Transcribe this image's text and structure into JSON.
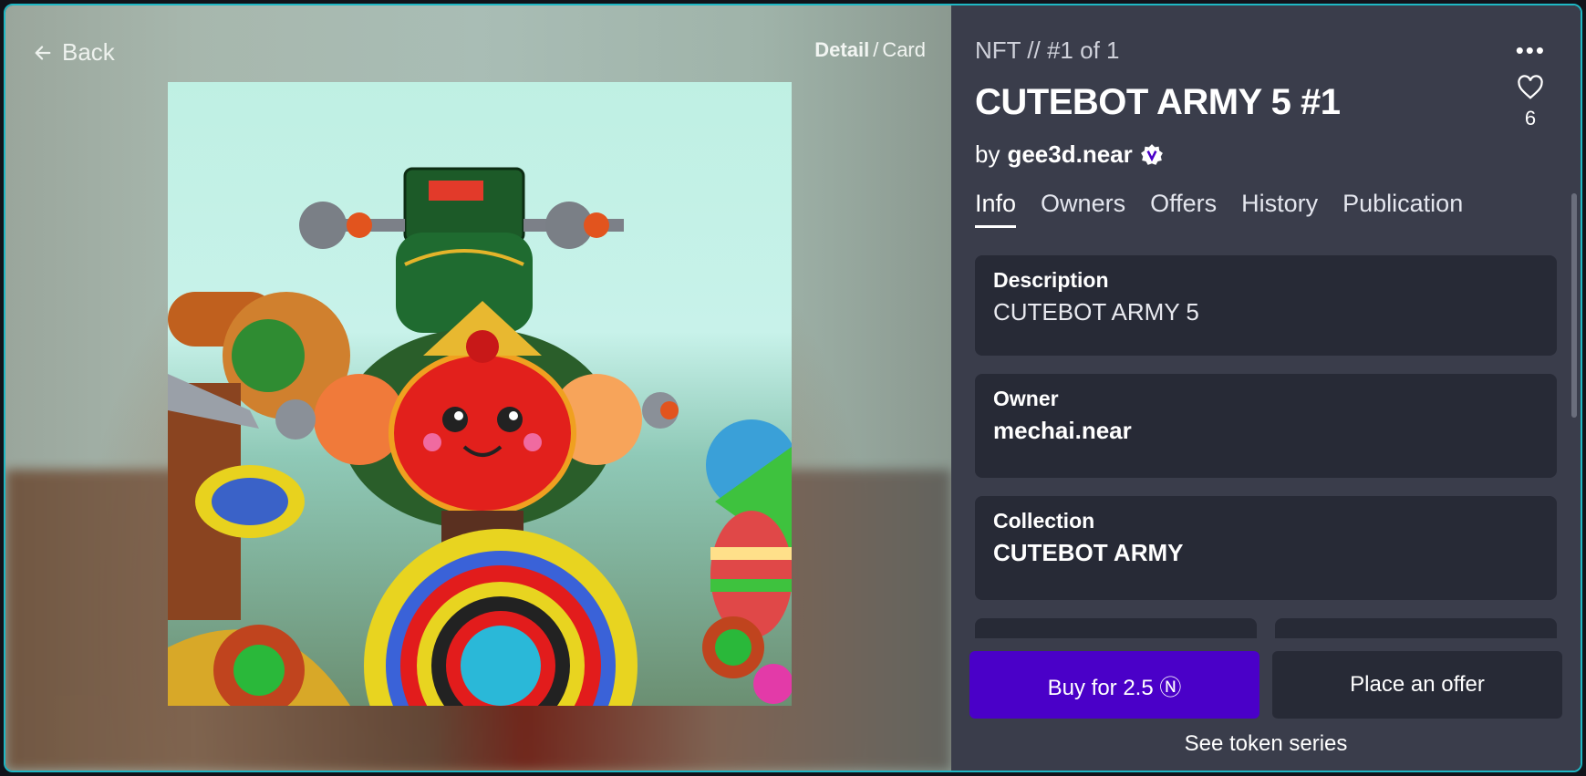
{
  "nav": {
    "back_label": "Back",
    "view_detail": "Detail",
    "view_sep": "/",
    "view_card": "Card"
  },
  "token": {
    "edition": "NFT // #1 of 1",
    "title": "CUTEBOT ARMY 5 #1",
    "by_prefix": "by",
    "creator": "gee3d.near",
    "likes": "6"
  },
  "tabs": [
    {
      "label": "Info",
      "active": true
    },
    {
      "label": "Owners",
      "active": false
    },
    {
      "label": "Offers",
      "active": false
    },
    {
      "label": "History",
      "active": false
    },
    {
      "label": "Publication",
      "active": false
    }
  ],
  "info": {
    "description_label": "Description",
    "description_value": "CUTEBOT ARMY 5",
    "owner_label": "Owner",
    "owner_value": "mechai.near",
    "collection_label": "Collection",
    "collection_value": "CUTEBOT ARMY"
  },
  "actions": {
    "buy_label": "Buy for 2.5 Ⓝ",
    "offer_label": "Place an offer",
    "see_series_label": "See token series"
  },
  "colors": {
    "accent": "#4a00c8",
    "panel_bg": "#3a3d4b",
    "card_bg": "#272a36",
    "border": "#1fb8c4"
  }
}
